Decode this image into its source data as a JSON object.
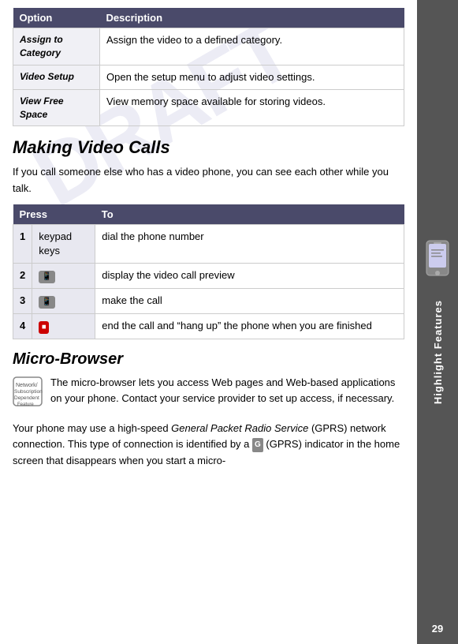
{
  "sidebar": {
    "title": "Highlight Features",
    "page_number": "29"
  },
  "first_table": {
    "headers": [
      "Option",
      "Description"
    ],
    "rows": [
      {
        "option": "Assign to Category",
        "description": "Assign the video to a defined category."
      },
      {
        "option": "Video Setup",
        "description": "Open the setup menu to adjust video settings."
      },
      {
        "option": "View Free Space",
        "description": "View memory space available for storing videos."
      }
    ]
  },
  "making_video_calls": {
    "heading": "Making Video Calls",
    "intro": "If you call someone else who has a video phone, you can see each other while you talk.",
    "press_table": {
      "headers": [
        "Press",
        "To"
      ],
      "rows": [
        {
          "step": "1",
          "press": "keypad keys",
          "to": "dial the phone number"
        },
        {
          "step": "2",
          "press": "📞",
          "to": "display the video call preview"
        },
        {
          "step": "3",
          "press": "📞",
          "to": "make the call"
        },
        {
          "step": "4",
          "press": "🔴",
          "to": "end the call and “hang up” the phone when you are finished"
        }
      ]
    }
  },
  "micro_browser": {
    "heading": "Micro-Browser",
    "network_note": "The micro-browser lets you access Web pages and Web-based applications on your phone. Contact your service provider to set up access, if necessary.",
    "body_text": "Your phone may use a high-speed General Packet Radio Service (GPRS) network connection. This type of connection is identified by a  (GPRS) indicator in the home screen that disappears when you start a micro-"
  }
}
